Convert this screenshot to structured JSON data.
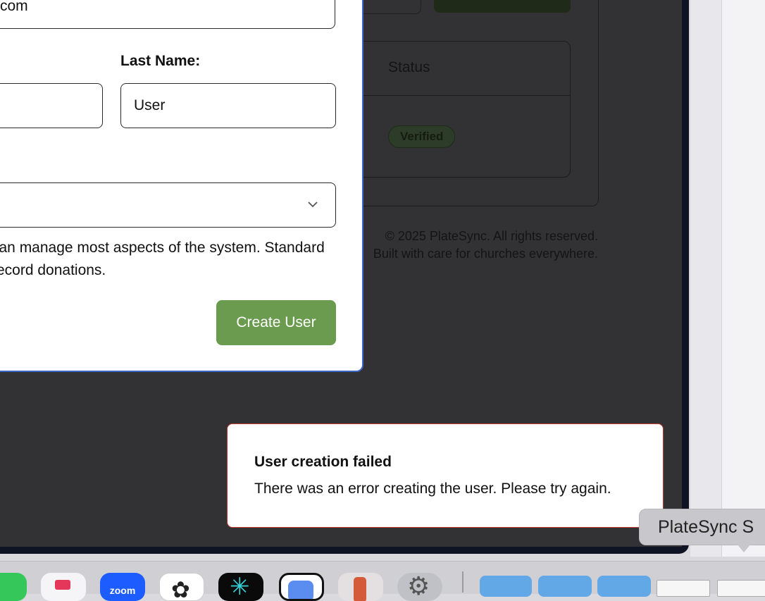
{
  "background": {
    "table_status_header": "Status",
    "status_badge": "Verified",
    "footer_copyright": "© 2025 PlateSync. All rights reserved.",
    "footer_tagline": "Built with care for churches everywhere."
  },
  "dialog": {
    "email_value": "com",
    "last_name_label": "Last Name:",
    "last_name_value": "User",
    "role_help_text": "can manage most aspects of the system. Standard\nrecord donations.",
    "create_button": "Create User"
  },
  "toast": {
    "title": "User creation failed",
    "message": "There was an error creating the user. Please try again."
  },
  "dock": {
    "tooltip": "PlateSync S",
    "zoom_label": "zoom",
    "items": [
      "facetime-icon",
      "news-icon",
      "zoom-icon",
      "chatgpt-icon",
      "perplexity-icon",
      "preview-icon",
      "iphone-mirroring-icon",
      "system-settings-icon",
      "folder-icon",
      "folder-icon",
      "folder-icon",
      "window-thumbnail",
      "window-thumbnail"
    ]
  },
  "colors": {
    "accent_button": "#6a9b4f",
    "dialog_focus_border": "#3a66c4",
    "toast_border": "#c0392b",
    "overlay": "#323234"
  }
}
